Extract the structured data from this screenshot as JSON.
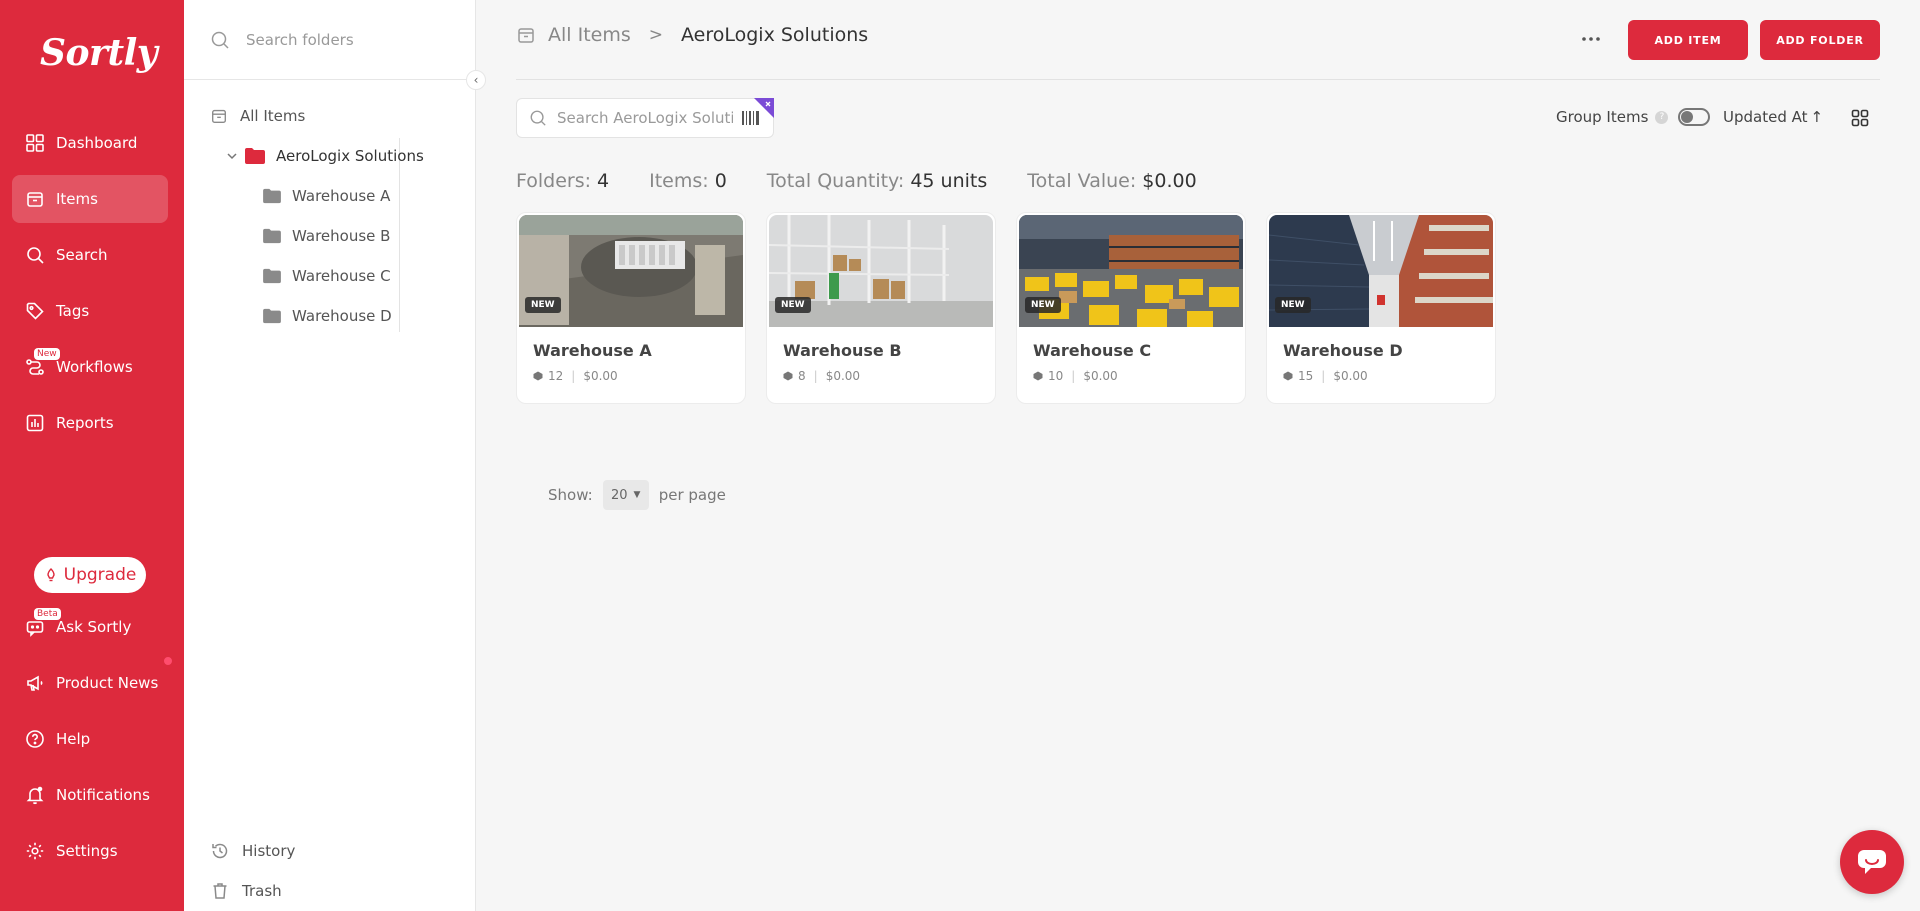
{
  "app": {
    "logo": "Sortly"
  },
  "sidebar": {
    "items": [
      {
        "label": "Dashboard",
        "icon": "dashboard-icon"
      },
      {
        "label": "Items",
        "icon": "items-icon",
        "active": true
      },
      {
        "label": "Search",
        "icon": "search-icon"
      },
      {
        "label": "Tags",
        "icon": "tag-icon"
      },
      {
        "label": "Workflows",
        "icon": "workflows-icon",
        "badge": "New"
      },
      {
        "label": "Reports",
        "icon": "reports-icon"
      }
    ],
    "upgrade_label": "Upgrade",
    "bottom_items": [
      {
        "label": "Ask Sortly",
        "icon": "chat-bot-icon",
        "badge": "Beta"
      },
      {
        "label": "Product News",
        "icon": "megaphone-icon"
      },
      {
        "label": "Help",
        "icon": "help-icon"
      },
      {
        "label": "Notifications",
        "icon": "bell-icon"
      },
      {
        "label": "Settings",
        "icon": "gear-icon"
      }
    ]
  },
  "folder_panel": {
    "search_placeholder": "Search folders",
    "all_items_label": "All Items",
    "root_folder": "AeroLogix Solutions",
    "subfolders": [
      "Warehouse A",
      "Warehouse B",
      "Warehouse C",
      "Warehouse D"
    ],
    "history_label": "History",
    "trash_label": "Trash"
  },
  "header": {
    "breadcrumb_root": "All Items",
    "breadcrumb_sep": ">",
    "breadcrumb_current": "AeroLogix Solutions",
    "add_item_label": "ADD ITEM",
    "add_folder_label": "ADD FOLDER"
  },
  "toolbar": {
    "search_placeholder": "Search AeroLogix Solutions",
    "group_items_label": "Group Items",
    "help_mark": "?",
    "sort_label": "Updated At",
    "sort_arrow": "↑"
  },
  "stats": {
    "folders_label": "Folders:",
    "folders_value": "4",
    "items_label": "Items:",
    "items_value": "0",
    "quantity_label": "Total Quantity:",
    "quantity_value": "45 units",
    "value_label": "Total Value:",
    "value_value": "$0.00"
  },
  "cards": [
    {
      "title": "Warehouse A",
      "badge": "NEW",
      "count": "12",
      "value": "$0.00"
    },
    {
      "title": "Warehouse B",
      "badge": "NEW",
      "count": "8",
      "value": "$0.00"
    },
    {
      "title": "Warehouse C",
      "badge": "NEW",
      "count": "10",
      "value": "$0.00"
    },
    {
      "title": "Warehouse D",
      "badge": "NEW",
      "count": "15",
      "value": "$0.00"
    }
  ],
  "pagination": {
    "show_label": "Show:",
    "per_page_value": "20",
    "per_page_label": "per page"
  },
  "colors": {
    "brand": "#dd2a3d",
    "background": "#f6f6f6",
    "folder_gray": "#8a8a8a",
    "folder_red": "#dd2a3d"
  }
}
